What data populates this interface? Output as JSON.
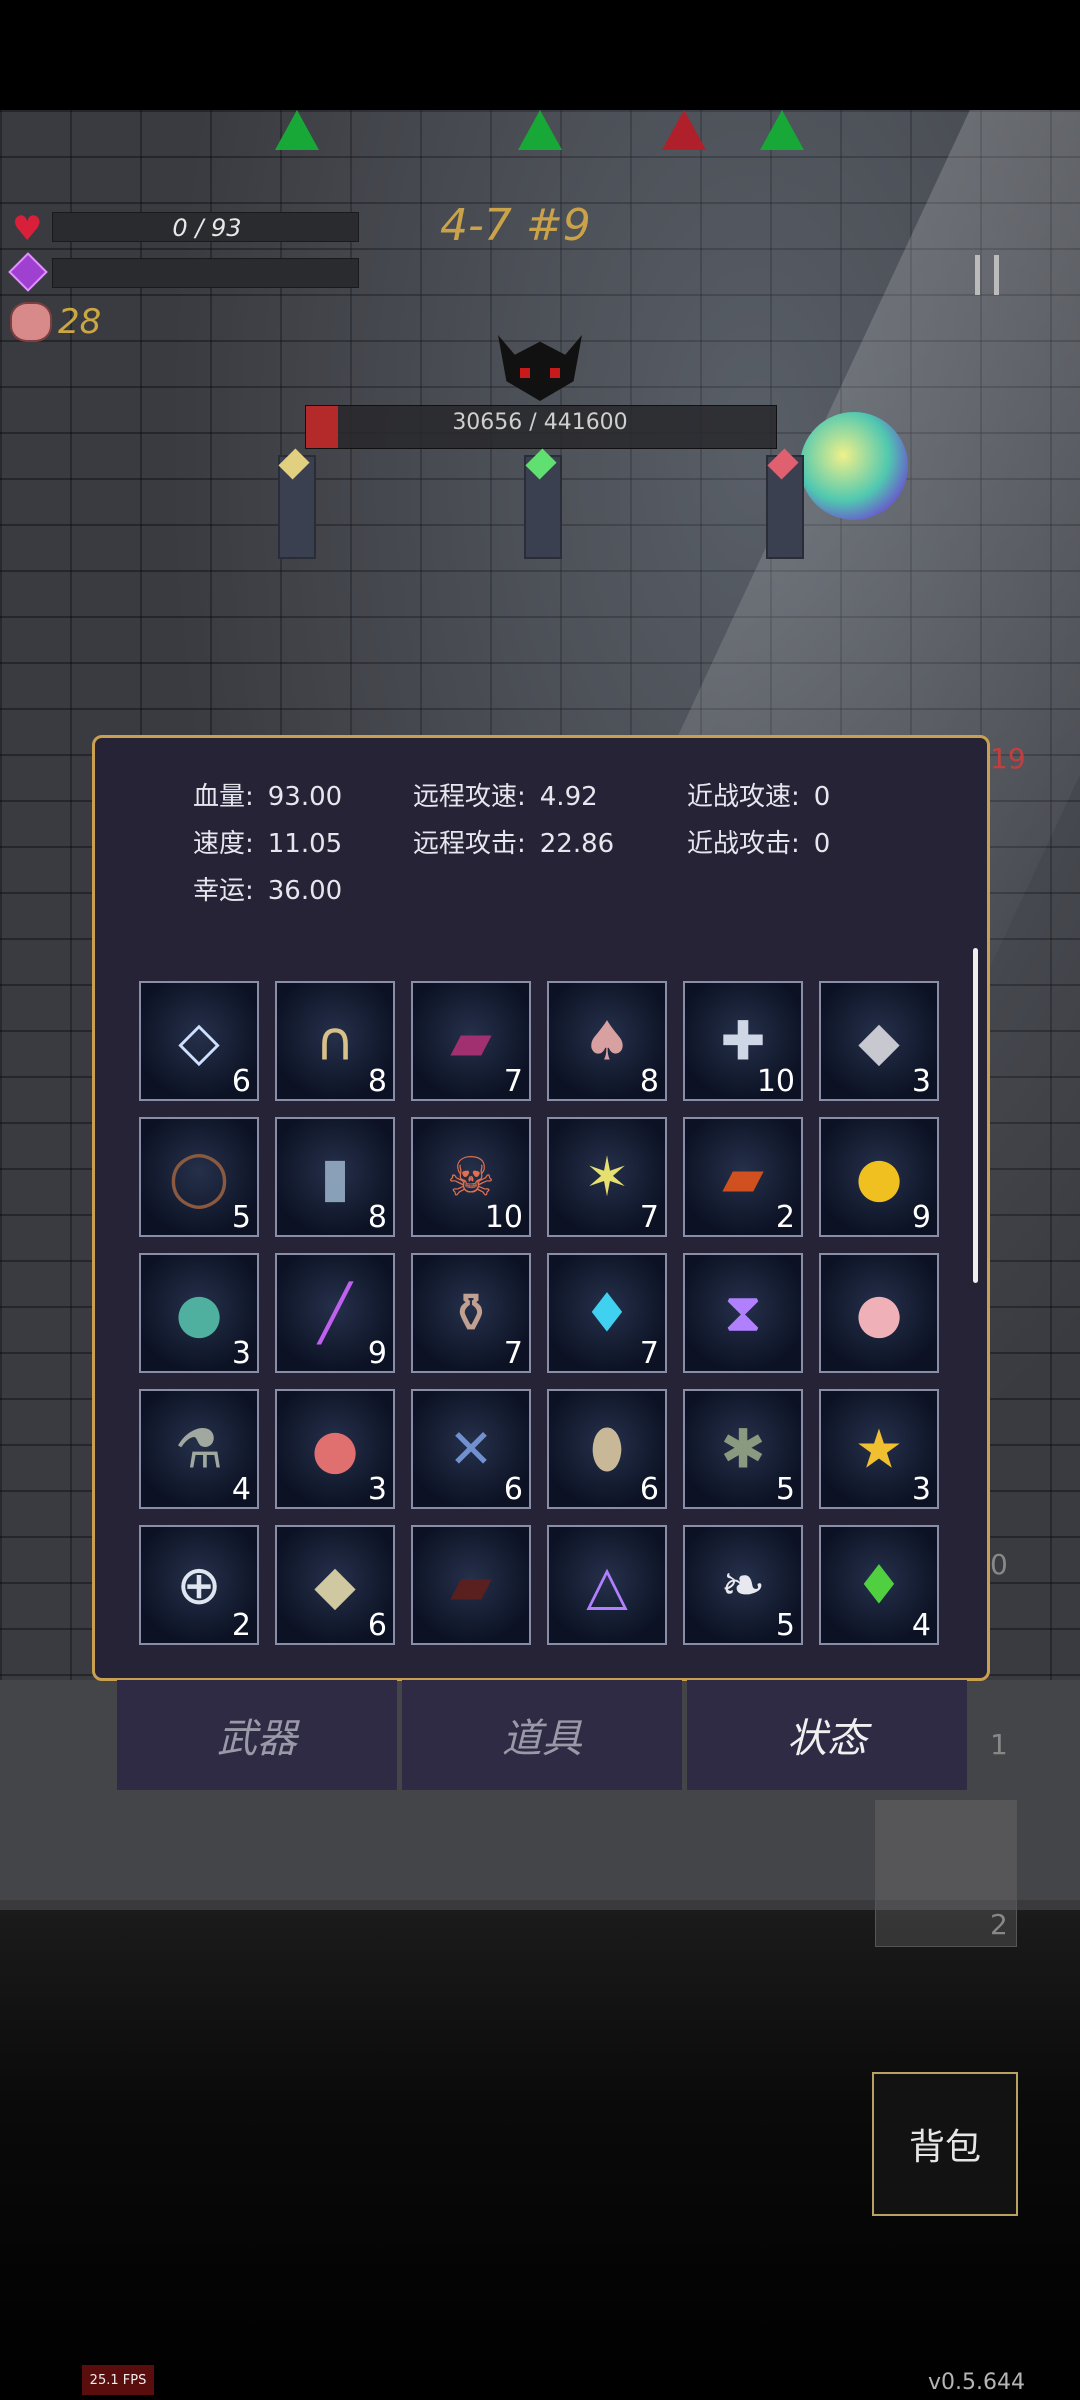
{
  "hud": {
    "hp_text": "0 / 93",
    "gold": "28",
    "level": "4-7 #9",
    "boss_hp_text": "30656 / 441600",
    "boss_hp_fraction": 0.069,
    "wave_markers": [
      "green",
      "green",
      "red",
      "green"
    ],
    "side_numbers": [
      "19",
      "0",
      "1",
      "2"
    ]
  },
  "stats": [
    {
      "label": "血量:",
      "value": "93.00"
    },
    {
      "label": "远程攻速:",
      "value": "4.92"
    },
    {
      "label": "近战攻速:",
      "value": "0"
    },
    {
      "label": "速度:",
      "value": "11.05"
    },
    {
      "label": "远程攻击:",
      "value": "22.86"
    },
    {
      "label": "近战攻击:",
      "value": "0"
    },
    {
      "label": "幸运:",
      "value": "36.00"
    }
  ],
  "items": [
    {
      "icon": "diamond-plate-icon",
      "count": "6"
    },
    {
      "icon": "horseshoe-icon",
      "count": "8"
    },
    {
      "icon": "spellbook-icon",
      "count": "7"
    },
    {
      "icon": "mushroom-icon",
      "count": "8"
    },
    {
      "icon": "medkit-icon",
      "count": "10"
    },
    {
      "icon": "silver-ore-icon",
      "count": "3"
    },
    {
      "icon": "thorn-wreath-icon",
      "count": "5"
    },
    {
      "icon": "bottle-icon",
      "count": "8"
    },
    {
      "icon": "skull-feather-icon",
      "count": "10"
    },
    {
      "icon": "star-crystal-icon",
      "count": "7"
    },
    {
      "icon": "red-tome-icon",
      "count": "2"
    },
    {
      "icon": "gold-coin-icon",
      "count": "9"
    },
    {
      "icon": "rainbow-orb-icon",
      "count": "3"
    },
    {
      "icon": "purple-wand-icon",
      "count": "9"
    },
    {
      "icon": "vase-icon",
      "count": "7"
    },
    {
      "icon": "blue-crystal-icon",
      "count": "7"
    },
    {
      "icon": "hourglass-rune-icon",
      "count": ""
    },
    {
      "icon": "piggy-bank-icon",
      "count": ""
    },
    {
      "icon": "flask-icon",
      "count": "4"
    },
    {
      "icon": "apple-icon",
      "count": "3"
    },
    {
      "icon": "dragonfly-icon",
      "count": "6"
    },
    {
      "icon": "egg-icon",
      "count": "6"
    },
    {
      "icon": "octopus-icon",
      "count": "5"
    },
    {
      "icon": "star-trophy-icon",
      "count": "3"
    },
    {
      "icon": "cross-ring-icon",
      "count": "2"
    },
    {
      "icon": "rocks-icon",
      "count": "6"
    },
    {
      "icon": "dark-tome-icon",
      "count": ""
    },
    {
      "icon": "triangle-rune-icon",
      "count": ""
    },
    {
      "icon": "feather-icon",
      "count": "5"
    },
    {
      "icon": "green-gem-icon",
      "count": "4"
    }
  ],
  "tabs": [
    "武器",
    "道具",
    "状态"
  ],
  "active_tab": "状态",
  "bag_label": "背包",
  "fps": "25.1 FPS",
  "version": "v0.5.644"
}
